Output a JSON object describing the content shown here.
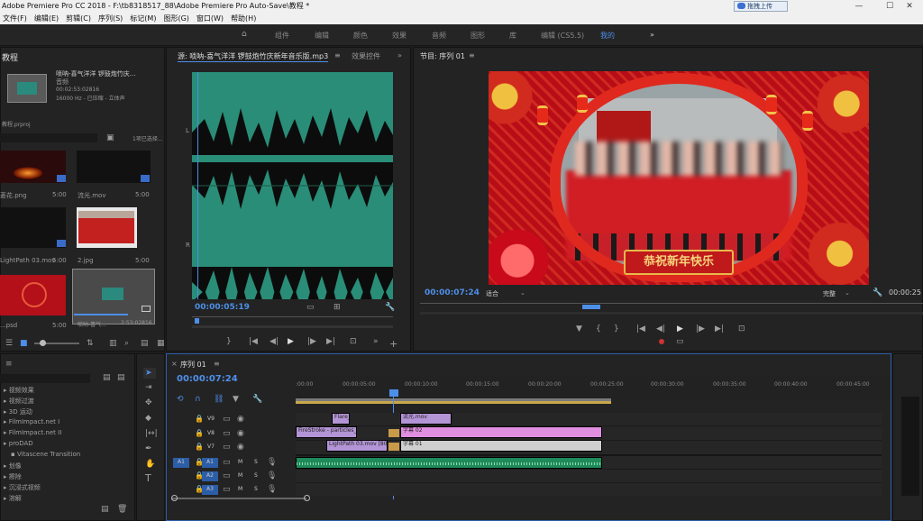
{
  "titlebar": {
    "text": "Adobe Premiere Pro CC 2018 - F:\\tb8318517_88\\Adobe Premiere Pro Auto-Save\\教程 *",
    "cloud_btn": "拖拽上传"
  },
  "menu": [
    "文件(F)",
    "编辑(E)",
    "剪辑(C)",
    "序列(S)",
    "标记(M)",
    "图形(G)",
    "窗口(W)",
    "帮助(H)"
  ],
  "workspaces": [
    "组件",
    "编辑",
    "颜色",
    "效果",
    "音频",
    "图形",
    "库",
    "编辑 (CS5.5)",
    "我的"
  ],
  "project": {
    "title": "教程",
    "clip_name": "唢呐-喜气洋洋 锣鼓炮竹庆...",
    "clip_type": "音频",
    "clip_duration": "00:02:53:02816",
    "clip_info": "16000 Hz - 已压缩 - 立体声",
    "file": "教程.prproj",
    "filter": "1项已选择...",
    "items": [
      {
        "name": "菱花.png",
        "dur": "5:00"
      },
      {
        "name": "流光.mov",
        "dur": "5:00"
      },
      {
        "name": "LightPath 03.mov",
        "dur": "5:00"
      },
      {
        "name": "2.jpg",
        "dur": "5:00"
      },
      {
        "name": "...psd",
        "dur": "5:00"
      },
      {
        "name": "唢呐-喜气...",
        "dur": "2:53:02816"
      }
    ]
  },
  "source": {
    "tab_active": "源: 唢呐-喜气洋洋 锣鼓炮竹庆新年音乐版.mp3",
    "tab_other": "效果控件",
    "timecode": "00:00:05:19"
  },
  "program": {
    "tab": "节目: 序列 01",
    "timecode": "00:00:07:24",
    "fit": "适合",
    "quality": "完整",
    "duration": "00:00:25",
    "banner": "恭祝新年快乐"
  },
  "effects": {
    "items": [
      "视频效果",
      "视频过渡",
      "3D 运动",
      "FilmImpact.net I",
      "FilmImpact.net II",
      "proDAD",
      "Vitascene Transition",
      "划像",
      "擦除",
      "沉浸式视频",
      "溶解"
    ]
  },
  "timeline": {
    "tab": "序列 01",
    "timecode": "00:00:07:24",
    "ruler": [
      ":00:00",
      "00:00:05:00",
      "00:00:10:00",
      "00:00:15:00",
      "00:00:20:00",
      "00:00:25:00",
      "00:00:30:00",
      "00:00:35:00",
      "00:00:40:00",
      "00:00:45:00"
    ],
    "tracks": [
      {
        "id": "V9",
        "src": ""
      },
      {
        "id": "V8",
        "src": ""
      },
      {
        "id": "V7",
        "src": ""
      },
      {
        "id": "A1",
        "src": "A1"
      },
      {
        "id": "A2",
        "src": ""
      },
      {
        "id": "A3",
        "src": ""
      }
    ],
    "clips": [
      {
        "label": "Flare_...",
        "color": "#b394d6"
      },
      {
        "label": "流光.mov",
        "color": "#b394d6"
      },
      {
        "label": "FireStroke - particles_mov",
        "color": "#b394d6"
      },
      {
        "label": "字幕 02",
        "color": "#e08fe0"
      },
      {
        "label": "LightPath 03.mov [80%]",
        "color": "#b394d6"
      },
      {
        "label": "字幕 01",
        "color": "#cfcfcf"
      }
    ],
    "track_btn_m": "M",
    "track_btn_s": "S"
  }
}
